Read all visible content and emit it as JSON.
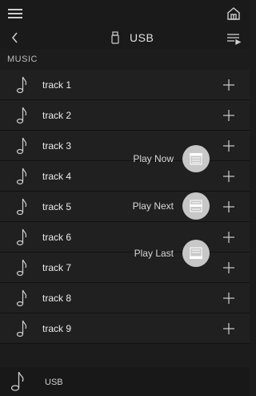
{
  "header": {
    "menu_icon": "hamburger-icon",
    "home_icon": "home-icon"
  },
  "nav": {
    "back_icon": "chevron-left-icon",
    "source_icon": "usb-icon",
    "title": "USB",
    "queue_icon": "queue-icon"
  },
  "section": {
    "label": "MUSIC"
  },
  "tracks": [
    {
      "title": "track 1"
    },
    {
      "title": "track 2"
    },
    {
      "title": "track 3"
    },
    {
      "title": "track 4"
    },
    {
      "title": "track 5"
    },
    {
      "title": "track 6"
    },
    {
      "title": "track 7"
    },
    {
      "title": "track 8"
    },
    {
      "title": "track 9"
    }
  ],
  "popup_menu": {
    "items": [
      {
        "label": "Play Now",
        "icon": "play-now-icon"
      },
      {
        "label": "Play Next",
        "icon": "play-next-icon"
      },
      {
        "label": "Play Last",
        "icon": "play-last-icon"
      }
    ]
  },
  "bottom_bar": {
    "icon": "music-note-icon",
    "label": "USB"
  },
  "colors": {
    "background": "#1c1c1c",
    "row": "#202020",
    "popup_button": "#c7c7c7",
    "text": "#e6e6e6"
  }
}
